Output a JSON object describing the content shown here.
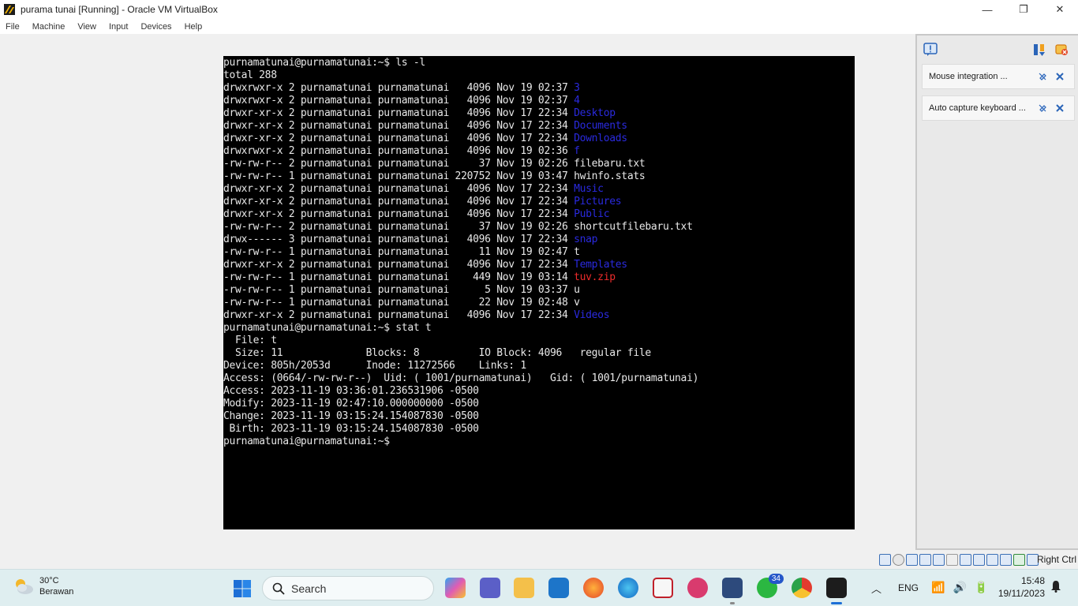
{
  "window": {
    "title": "purama tunai [Running] - Oracle VM VirtualBox",
    "minimize": "—",
    "restore": "❐",
    "close": "✕"
  },
  "menu": [
    "File",
    "Machine",
    "View",
    "Input",
    "Devices",
    "Help"
  ],
  "terminal": {
    "prompt": "purnamatunai@purnamatunai:~$",
    "cmd1": " ls -l",
    "total": "total 288",
    "listing": [
      {
        "meta": "drwxrwxr-x 2 purnamatunai purnamatunai   4096 Nov 19 02:37 ",
        "name": "3",
        "kind": "dir"
      },
      {
        "meta": "drwxrwxr-x 2 purnamatunai purnamatunai   4096 Nov 19 02:37 ",
        "name": "4",
        "kind": "dir"
      },
      {
        "meta": "drwxr-xr-x 2 purnamatunai purnamatunai   4096 Nov 17 22:34 ",
        "name": "Desktop",
        "kind": "dir"
      },
      {
        "meta": "drwxr-xr-x 2 purnamatunai purnamatunai   4096 Nov 17 22:34 ",
        "name": "Documents",
        "kind": "dir"
      },
      {
        "meta": "drwxr-xr-x 2 purnamatunai purnamatunai   4096 Nov 17 22:34 ",
        "name": "Downloads",
        "kind": "dir"
      },
      {
        "meta": "drwxrwxr-x 2 purnamatunai purnamatunai   4096 Nov 19 02:36 ",
        "name": "f",
        "kind": "dir"
      },
      {
        "meta": "-rw-rw-r-- 2 purnamatunai purnamatunai     37 Nov 19 02:26 ",
        "name": "filebaru.txt",
        "kind": "plain"
      },
      {
        "meta": "-rw-rw-r-- 1 purnamatunai purnamatunai 220752 Nov 19 03:47 ",
        "name": "hwinfo.stats",
        "kind": "plain"
      },
      {
        "meta": "drwxr-xr-x 2 purnamatunai purnamatunai   4096 Nov 17 22:34 ",
        "name": "Music",
        "kind": "dir"
      },
      {
        "meta": "drwxr-xr-x 2 purnamatunai purnamatunai   4096 Nov 17 22:34 ",
        "name": "Pictures",
        "kind": "dir"
      },
      {
        "meta": "drwxr-xr-x 2 purnamatunai purnamatunai   4096 Nov 17 22:34 ",
        "name": "Public",
        "kind": "dir"
      },
      {
        "meta": "-rw-rw-r-- 2 purnamatunai purnamatunai     37 Nov 19 02:26 ",
        "name": "shortcutfilebaru.txt",
        "kind": "plain"
      },
      {
        "meta": "drwx------ 3 purnamatunai purnamatunai   4096 Nov 17 22:34 ",
        "name": "snap",
        "kind": "dir"
      },
      {
        "meta": "-rw-rw-r-- 1 purnamatunai purnamatunai     11 Nov 19 02:47 ",
        "name": "t",
        "kind": "plain"
      },
      {
        "meta": "drwxr-xr-x 2 purnamatunai purnamatunai   4096 Nov 17 22:34 ",
        "name": "Templates",
        "kind": "dir"
      },
      {
        "meta": "-rw-rw-r-- 1 purnamatunai purnamatunai    449 Nov 19 03:14 ",
        "name": "tuv.zip",
        "kind": "zip"
      },
      {
        "meta": "-rw-rw-r-- 1 purnamatunai purnamatunai      5 Nov 19 03:37 ",
        "name": "u",
        "kind": "plain"
      },
      {
        "meta": "-rw-rw-r-- 1 purnamatunai purnamatunai     22 Nov 19 02:48 ",
        "name": "v",
        "kind": "plain"
      },
      {
        "meta": "drwxr-xr-x 2 purnamatunai purnamatunai   4096 Nov 17 22:34 ",
        "name": "Videos",
        "kind": "dir"
      }
    ],
    "cmd2": " stat t",
    "stat": [
      "  File: t",
      "  Size: 11              Blocks: 8          IO Block: 4096   regular file",
      "Device: 805h/2053d      Inode: 11272566    Links: 1",
      "Access: (0664/-rw-rw-r--)  Uid: ( 1001/purnamatunai)   Gid: ( 1001/purnamatunai)",
      "Access: 2023-11-19 03:36:01.236531906 -0500",
      "Modify: 2023-11-19 02:47:10.000000000 -0500",
      "Change: 2023-11-19 03:15:24.154087830 -0500",
      " Birth: 2023-11-19 03:15:24.154087830 -0500"
    ]
  },
  "notifications": [
    {
      "text": "Mouse integration ..."
    },
    {
      "text": "Auto capture keyboard ..."
    }
  ],
  "status": {
    "host_key": "Right Ctrl"
  },
  "taskbar": {
    "weather_temp": "30°C",
    "weather_desc": "Berawan",
    "search_label": "Search",
    "whatsapp_badge": "34",
    "lang": "ENG",
    "time": "15:48",
    "date": "19/11/2023"
  }
}
